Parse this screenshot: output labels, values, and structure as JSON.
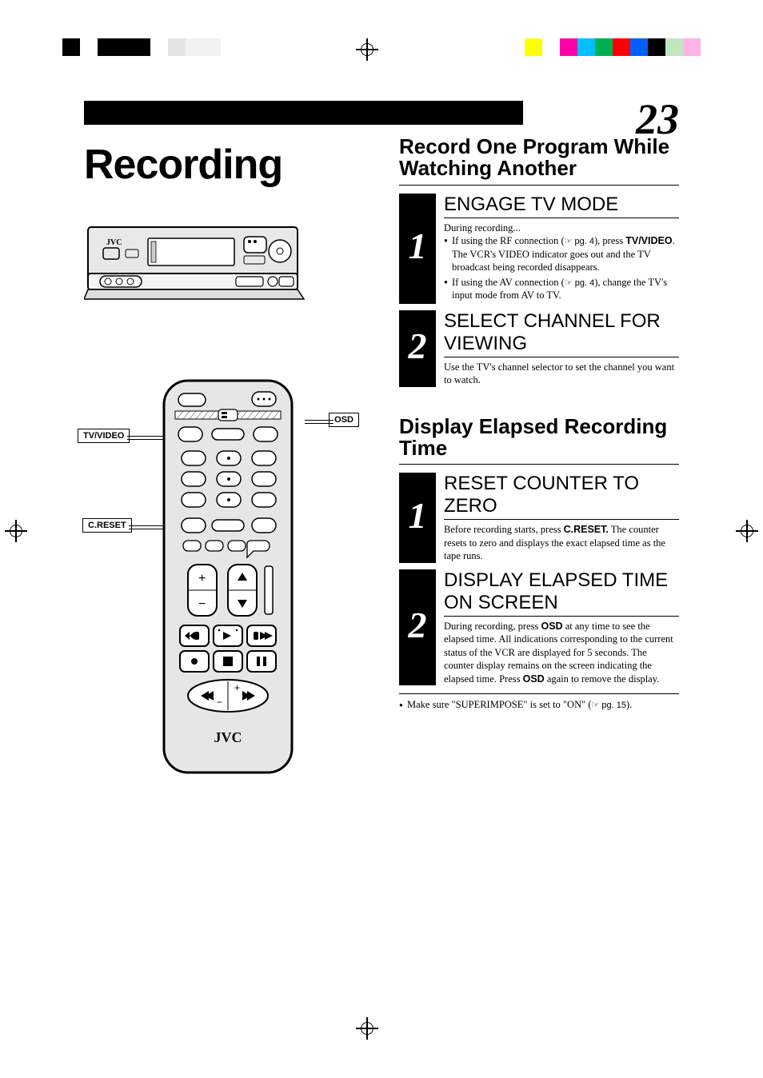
{
  "page_number": "23",
  "title": "Recording",
  "remote_labels": {
    "tv_video": "TV/VIDEO",
    "osd": "OSD",
    "c_reset": "C.RESET"
  },
  "remote_brand": "JVC",
  "vcr_brand": "JVC",
  "section_a": {
    "heading": "Record One Program While Watching Another",
    "steps": [
      {
        "num": "1",
        "title": "ENGAGE TV MODE",
        "intro": "During recording...",
        "bullets": [
          {
            "pre": "If using the RF connection (",
            "ref": "☞ pg. 4",
            "mid": "), press ",
            "bold": "TV/VIDEO",
            "post": ". The VCR's VIDEO indicator goes out and the TV broadcast being recorded disappears."
          },
          {
            "pre": "If using the AV connection (",
            "ref": "☞ pg. 4",
            "mid": "), change the TV's input mode from AV to TV.",
            "bold": "",
            "post": ""
          }
        ]
      },
      {
        "num": "2",
        "title": "SELECT CHANNEL FOR VIEWING",
        "body": "Use the TV's channel selector to set the channel you want to watch."
      }
    ]
  },
  "section_b": {
    "heading": "Display Elapsed Recording Time",
    "steps": [
      {
        "num": "1",
        "title": "RESET COUNTER TO ZERO",
        "body_pre": "Before recording starts, press ",
        "body_bold": "C.RESET.",
        "body_post": " The counter resets to zero and displays the exact elapsed time as the tape runs."
      },
      {
        "num": "2",
        "title": "DISPLAY ELAPSED TIME ON SCREEN",
        "body_pre": "During recording, press ",
        "body_bold1": "OSD",
        "body_mid": " at any time to see the elapsed time. All indications corresponding to the current status of the VCR are displayed for 5 seconds. The counter display remains on the screen indicating the elapsed time. Press ",
        "body_bold2": "OSD",
        "body_post": " again to remove the display."
      }
    ],
    "note_pre": "Make sure \"SUPERIMPOSE\" is set to \"ON\" (",
    "note_ref": "☞ pg. 15",
    "note_post": ")."
  }
}
